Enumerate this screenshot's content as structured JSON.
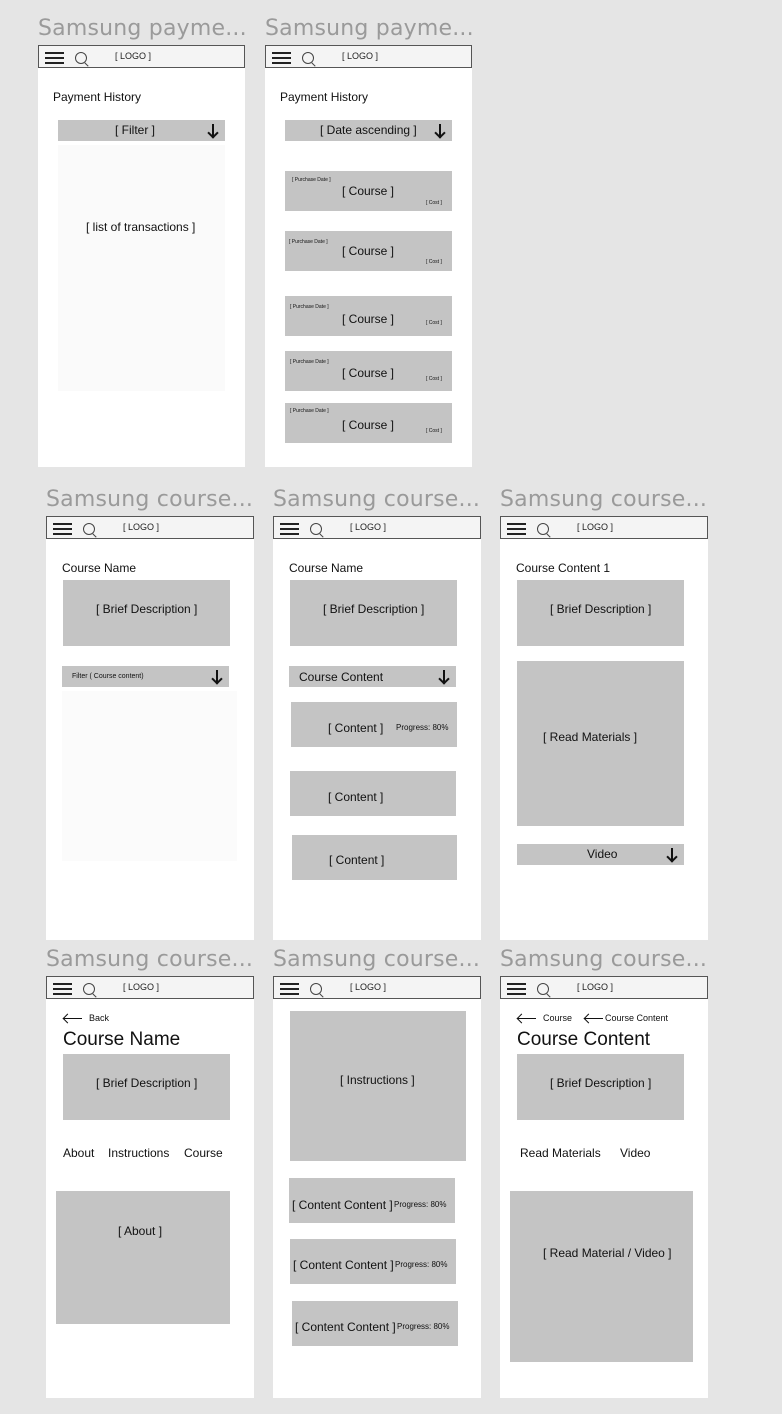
{
  "frames": {
    "ph1": {
      "title": "Samsung payme...",
      "logo": "[ LOGO ]",
      "heading": "Payment History",
      "filter": "[ Filter ]",
      "list": "[ list of transactions ]"
    },
    "ph2": {
      "title": "Samsung payme...",
      "logo": "[ LOGO ]",
      "heading": "Payment History",
      "sort": "[ Date ascending ]",
      "rows": [
        {
          "date": "[ Purchase Date ]",
          "course": "[ Course ]",
          "cost": "[ Cost ]"
        },
        {
          "date": "[ Purchase Date ]",
          "course": "[ Course ]",
          "cost": "[ Cost ]"
        },
        {
          "date": "[ Purchase Date ]",
          "course": "[ Course ]",
          "cost": "[ Cost ]"
        },
        {
          "date": "[ Purchase Date ]",
          "course": "[ Course ]",
          "cost": "[ Cost ]"
        },
        {
          "date": "[ Purchase Date ]",
          "course": "[ Course ]",
          "cost": "[ Cost ]"
        }
      ]
    },
    "c1": {
      "title": "Samsung course...",
      "logo": "[ LOGO ]",
      "heading": "Course Name",
      "desc": "[ Brief Description ]",
      "filter": "Filter ( Course content)"
    },
    "c2": {
      "title": "Samsung course...",
      "logo": "[ LOGO ]",
      "heading": "Course Name",
      "desc": "[ Brief Description ]",
      "dropdown": "Course Content",
      "items": [
        {
          "label": "[ Content ]",
          "progress": "Progress: 80%"
        },
        {
          "label": "[ Content ]"
        },
        {
          "label": "[ Content ]"
        }
      ]
    },
    "c3": {
      "title": "Samsung course...",
      "logo": "[ LOGO ]",
      "heading": "Course Content 1",
      "desc": "[ Brief Description ]",
      "materials": "[ Read Materials ]",
      "video": "Video"
    },
    "c4": {
      "title": "Samsung course...",
      "logo": "[ LOGO ]",
      "back": "Back",
      "heading": "Course Name",
      "desc": "[ Brief Description ]",
      "tabs": [
        "About",
        "Instructions",
        "Course"
      ],
      "about": "[ About ]"
    },
    "c5": {
      "title": "Samsung course...",
      "logo": "[ LOGO ]",
      "instructions": "[ Instructions ]",
      "items": [
        {
          "label": "[ Content Content ]",
          "progress": "Progress: 80%"
        },
        {
          "label": "[ Content Content ]",
          "progress": "Progress: 80%"
        },
        {
          "label": "[ Content Content ]",
          "progress": "Progress: 80%"
        }
      ]
    },
    "c6": {
      "title": "Samsung course...",
      "logo": "[ LOGO ]",
      "crumb1": "Course",
      "crumb2": "Course Content",
      "heading": "Course Content",
      "desc": "[ Brief Description ]",
      "tabs": [
        "Read Materials",
        "Video"
      ],
      "content": "[ Read Material / Video ]"
    }
  }
}
